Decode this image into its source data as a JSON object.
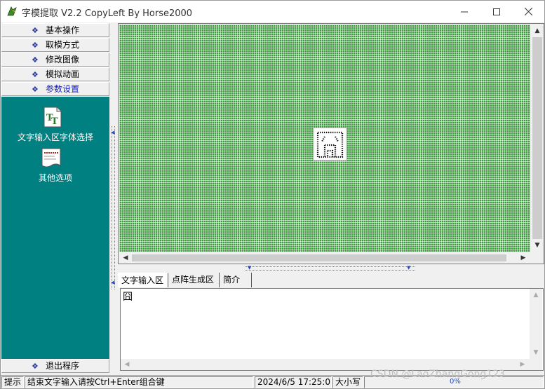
{
  "window": {
    "title": "字模提取 V2.2  CopyLeft By Horse2000",
    "minimize_icon": "minimize-icon",
    "maximize_icon": "maximize-icon",
    "close_icon": "close-icon"
  },
  "sidebar": {
    "items": [
      {
        "label": "基本操作"
      },
      {
        "label": "取模方式"
      },
      {
        "label": "修改图像"
      },
      {
        "label": "模拟动画"
      },
      {
        "label": "参数设置",
        "active": true
      }
    ],
    "panel_items": [
      {
        "label": "文字输入区字体选择",
        "icon": "font-tt-icon"
      },
      {
        "label": "其他选项",
        "icon": "document-icon"
      }
    ],
    "exit_label": "退出程序",
    "bullet": "❖"
  },
  "tabs": [
    {
      "label": "文字输入区"
    },
    {
      "label": "点阵生成区"
    },
    {
      "label": "简介"
    }
  ],
  "text_area": {
    "content": "囧"
  },
  "statusbar": {
    "hint_label": "提示",
    "message": "结束文字输入请按Ctrl+Enter组合键",
    "datetime": "2024/6/5 17:25:07",
    "caps": "大小写",
    "progress": "0%"
  },
  "watermark": "CSDN @LaoZhangGong123",
  "colors": {
    "panel_bg": "#008080",
    "matrix_bg": "#3e9c3e",
    "active_link": "#1a22c8"
  }
}
